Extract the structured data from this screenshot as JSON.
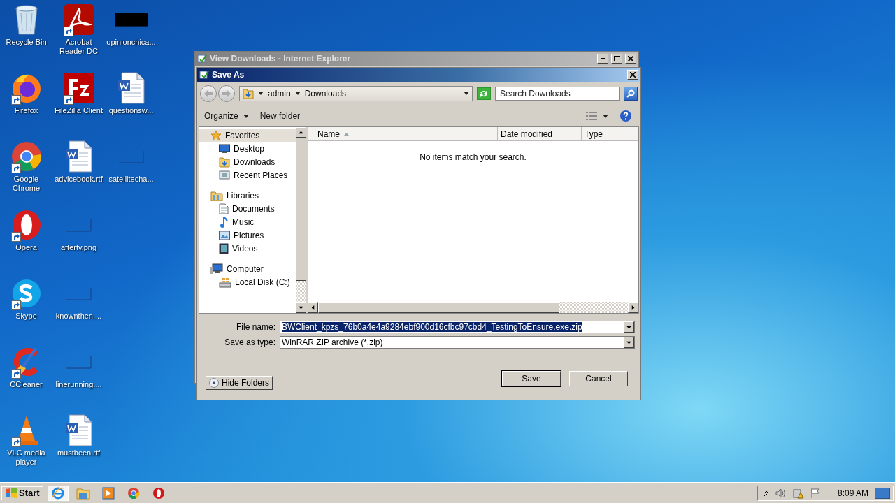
{
  "desktop_icons": [
    {
      "label": "Recycle Bin",
      "shortcut": false
    },
    {
      "label": "Firefox",
      "shortcut": true
    },
    {
      "label": "Google Chrome",
      "shortcut": true
    },
    {
      "label": "Opera",
      "shortcut": true
    },
    {
      "label": "Skype",
      "shortcut": true
    },
    {
      "label": "CCleaner",
      "shortcut": true
    },
    {
      "label": "VLC media player",
      "shortcut": true
    },
    {
      "label": "Acrobat Reader DC",
      "shortcut": true
    },
    {
      "label": "FileZilla Client",
      "shortcut": true
    },
    {
      "label": "advicebook.rtf",
      "shortcut": false
    },
    {
      "label": "aftertv.png",
      "shortcut": false
    },
    {
      "label": "knownthen....",
      "shortcut": false
    },
    {
      "label": "linerunning....",
      "shortcut": false
    },
    {
      "label": "mustbeen.rtf",
      "shortcut": false
    },
    {
      "label": "opinionchica...",
      "shortcut": false
    },
    {
      "label": "questionsw...",
      "shortcut": false
    },
    {
      "label": "satellitecha...",
      "shortcut": false
    }
  ],
  "background_window": {
    "title": "View Downloads - Internet Explorer"
  },
  "dialog": {
    "title": "Save As",
    "breadcrumb": [
      "admin",
      "Downloads"
    ],
    "search": {
      "placeholder": "Search Downloads"
    },
    "toolbar": [
      {
        "label": "Organize",
        "dropdown": true
      },
      {
        "label": "New folder",
        "dropdown": false
      }
    ],
    "navigation": [
      {
        "label": "Favorites",
        "selected": true,
        "children": [
          {
            "label": "Desktop",
            "selected": false
          },
          {
            "label": "Downloads",
            "selected": false
          },
          {
            "label": "Recent Places",
            "selected": false
          }
        ]
      },
      {
        "label": "Libraries",
        "selected": false,
        "children": [
          {
            "label": "Documents",
            "selected": false
          },
          {
            "label": "Music",
            "selected": false
          },
          {
            "label": "Pictures",
            "selected": false
          },
          {
            "label": "Videos",
            "selected": false
          }
        ]
      },
      {
        "label": "Computer",
        "selected": false,
        "children": [
          {
            "label": "Local Disk (C:)",
            "selected": false
          }
        ]
      }
    ],
    "columns": [
      {
        "label": "Name",
        "sorted": true
      },
      {
        "label": "Date modified",
        "sorted": false
      },
      {
        "label": "Type",
        "sorted": false
      }
    ],
    "empty_message": "No items match your search.",
    "file_name": {
      "label": "File name:",
      "value": "BWClient_kpzs_76b0a4e4a9284ebf900d16cfbc97cbd4_TestingToEnsure.exe.zip",
      "highlighted": true
    },
    "save_type": {
      "label": "Save as type:",
      "value": "WinRAR ZIP archive (*.zip)"
    },
    "hide_folders": "Hide Folders",
    "buttons": [
      {
        "label": "Save",
        "default": true
      },
      {
        "label": "Cancel",
        "default": false
      }
    ]
  },
  "taskbar": {
    "start": "Start",
    "apps": [
      {
        "active": true
      },
      {
        "active": false
      },
      {
        "active": false
      },
      {
        "active": false
      },
      {
        "active": false
      }
    ],
    "clock": "8:09 AM"
  }
}
